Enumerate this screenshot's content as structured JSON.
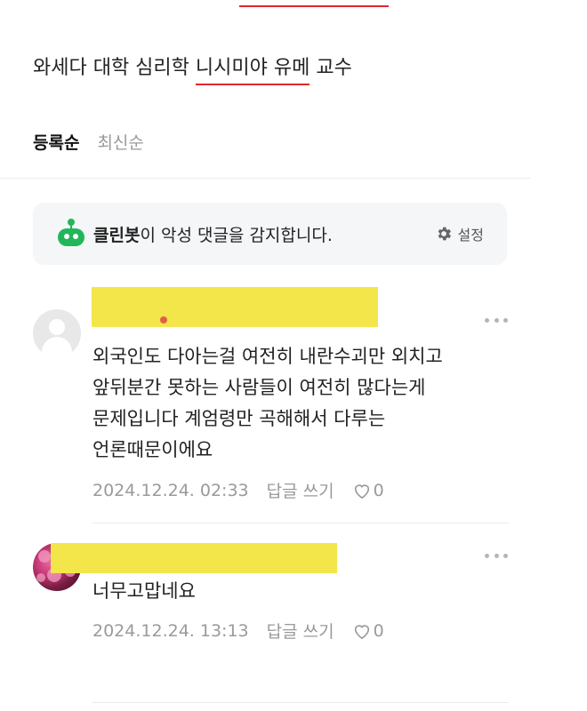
{
  "article": {
    "line": "와세다 대학 심리학 니시미야 유메 교수",
    "line_prefix": "와세다 대학 심리학 ",
    "line_highlight": "니시미야 유메",
    "line_suffix": " 교수"
  },
  "sort": {
    "active": "등록순",
    "inactive": "최신순"
  },
  "cleanbot": {
    "brand": "클린봇",
    "message": "이 악성 댓글을 감지합니다.",
    "settings_label": "설정"
  },
  "comments": [
    {
      "lines": [
        "외국인도 다아는걸 여전히 내란수괴만 외치고",
        "앞뒤분간 못하는 사람들이 여전히 많다는게",
        "문제입니다 계엄령만 곡해해서 다루는",
        "언론때문이에요"
      ],
      "date": "2024.12.24. 02:33",
      "reply_label": "답글 쓰기",
      "likes": "0"
    },
    {
      "lines": [
        "너무고맙네요"
      ],
      "date": "2024.12.24. 13:13",
      "reply_label": "답글 쓰기",
      "likes": "0"
    }
  ],
  "colors": {
    "accent_underline": "#e0282e",
    "cleanbot_green": "#22b65a",
    "redaction_yellow": "#f2e64a"
  }
}
